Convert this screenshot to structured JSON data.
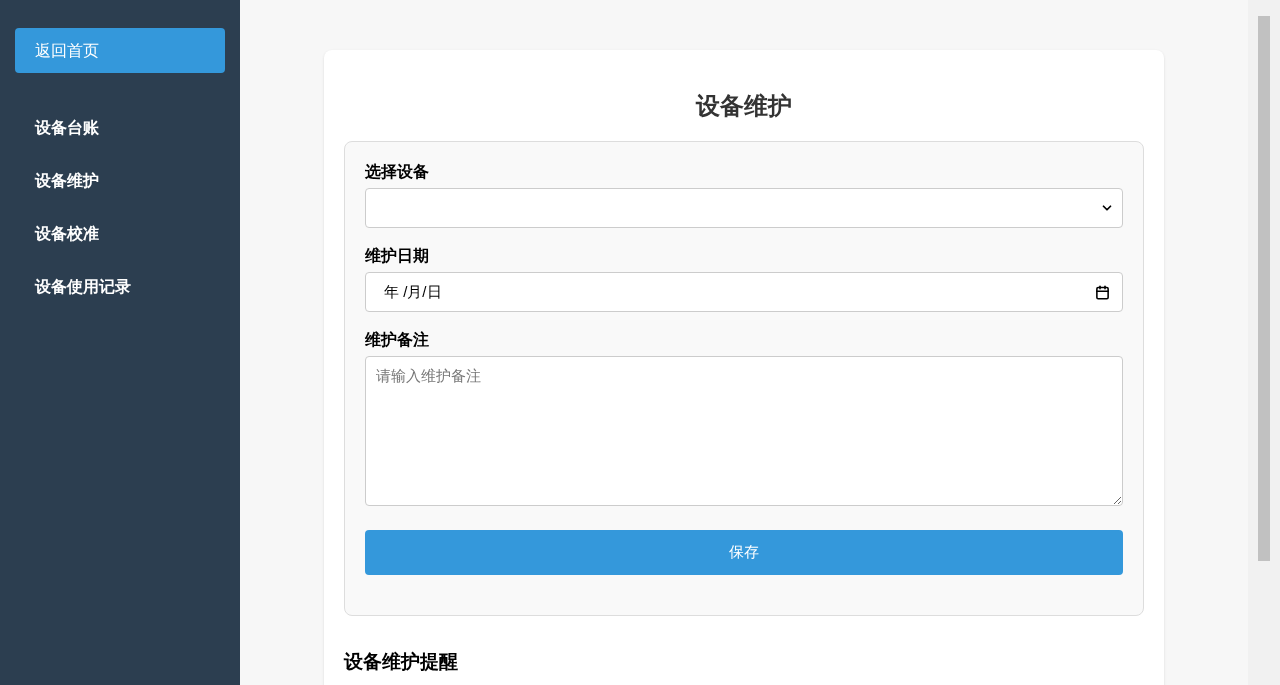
{
  "sidebar": {
    "home_button": "返回首页",
    "items": [
      {
        "label": "设备台账"
      },
      {
        "label": "设备维护"
      },
      {
        "label": "设备校准"
      },
      {
        "label": "设备使用记录"
      }
    ]
  },
  "card": {
    "title": "设备维护",
    "form": {
      "fields": [
        {
          "kind": "select",
          "label": "选择设备"
        },
        {
          "kind": "date",
          "label": "维护日期",
          "value": "年 /月/日"
        },
        {
          "kind": "textarea",
          "label": "维护备注",
          "placeholder": "请输入维护备注"
        }
      ],
      "submit": "保存"
    },
    "section_heading": "设备维护提醒"
  }
}
